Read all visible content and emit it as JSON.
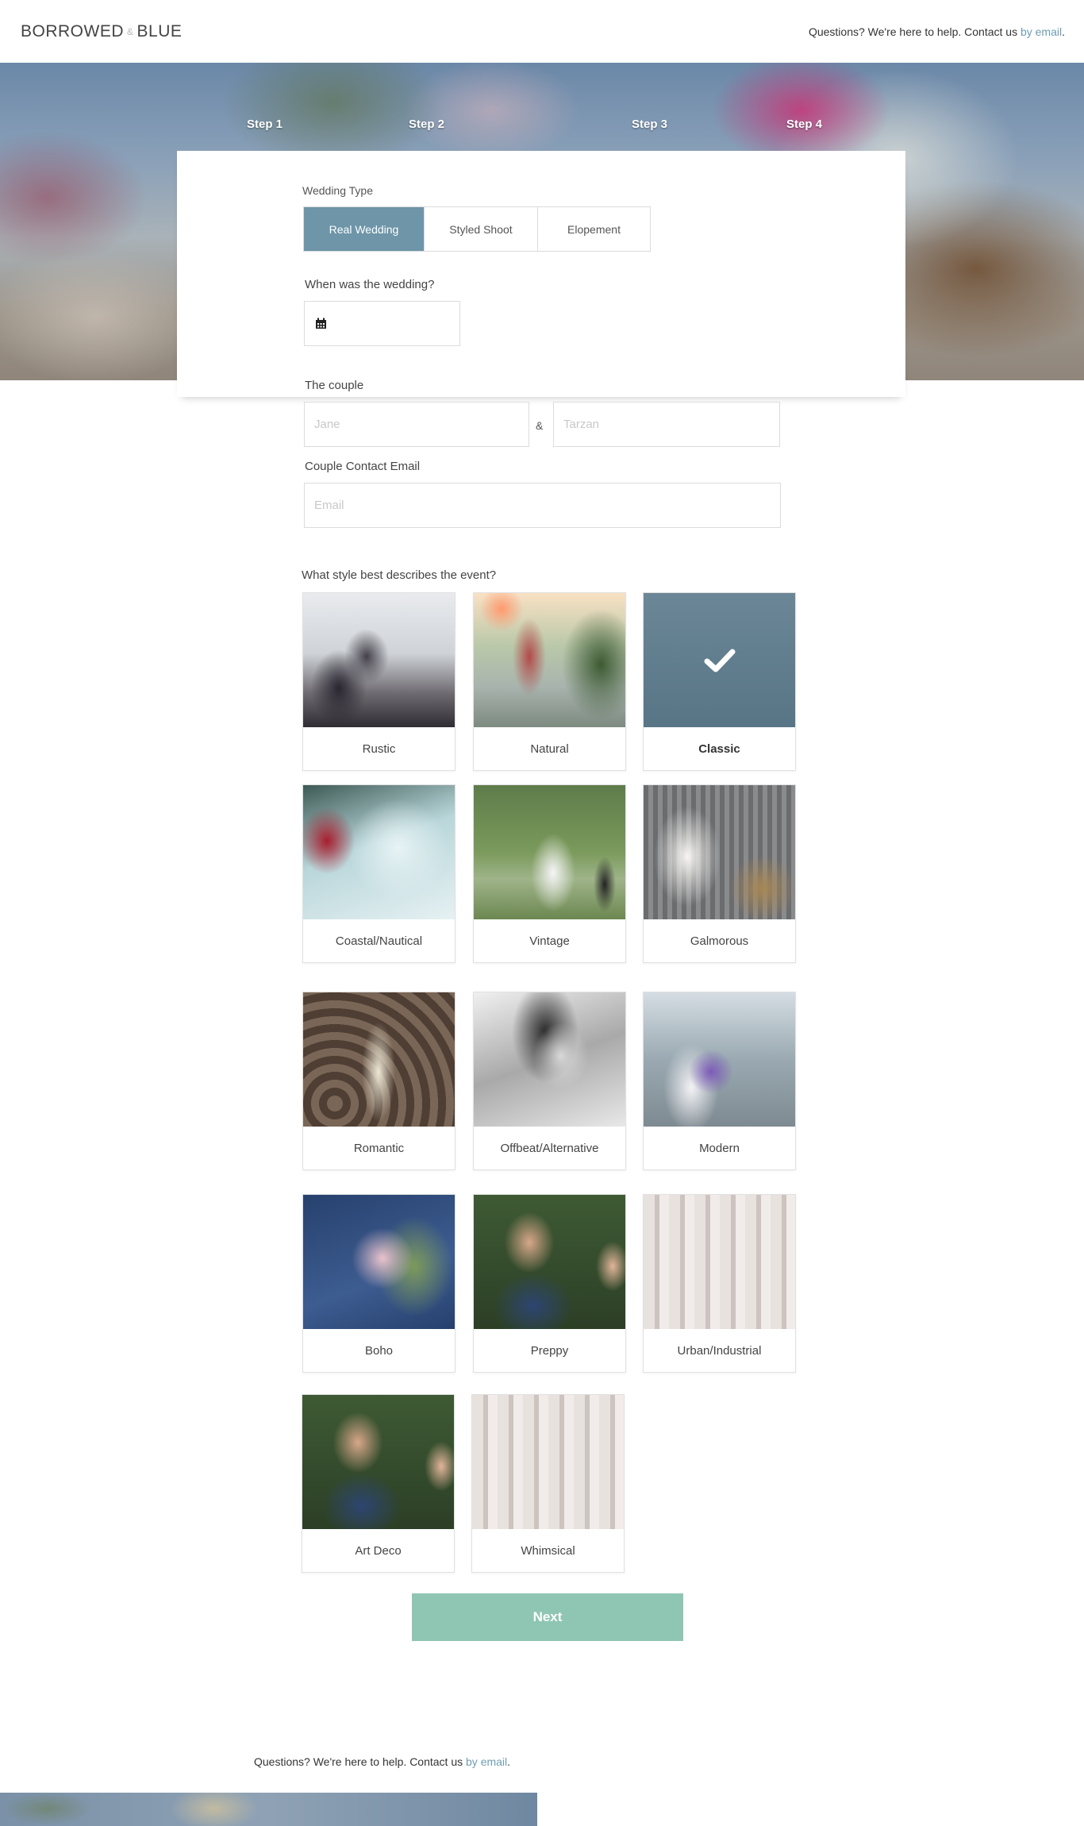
{
  "header": {
    "logo_left": "BORROWED",
    "logo_amp": "&",
    "logo_right": "BLUE",
    "help_text": "Questions? We're here to help. Contact us ",
    "help_link": "by email",
    "help_end": "."
  },
  "steps": [
    "Step 1",
    "Step 2",
    "Step 3",
    "Step 4"
  ],
  "form": {
    "wedding_type_label": "Wedding Type",
    "wedding_types": [
      "Real Wedding",
      "Styled Shoot",
      "Elopement"
    ],
    "selected_wedding_type": "Real Wedding",
    "date_label": "When was the wedding?",
    "date_value": "",
    "couple_label": "The couple",
    "partner1_placeholder": "Jane",
    "partner2_placeholder": "Tarzan",
    "couple_separator": "&",
    "email_label": "Couple Contact Email",
    "email_placeholder": "Email",
    "style_label": "What style best describes the event?"
  },
  "styles": [
    {
      "name": "Rustic",
      "selected": false
    },
    {
      "name": "Natural",
      "selected": false
    },
    {
      "name": "Classic",
      "selected": true
    },
    {
      "name": "Coastal/Nautical",
      "selected": false
    },
    {
      "name": "Vintage",
      "selected": false
    },
    {
      "name": "Galmorous",
      "selected": false
    },
    {
      "name": "Romantic",
      "selected": false
    },
    {
      "name": "Offbeat/Alternative",
      "selected": false
    },
    {
      "name": "Modern",
      "selected": false
    },
    {
      "name": "Boho",
      "selected": false
    },
    {
      "name": "Preppy",
      "selected": false
    },
    {
      "name": "Urban/Industrial",
      "selected": false
    },
    {
      "name": "Art Deco",
      "selected": false
    },
    {
      "name": "Whimsical",
      "selected": false
    }
  ],
  "next_button": "Next",
  "footer": {
    "help_text": "Questions? We're here to help. Contact us ",
    "help_link": "by email",
    "help_end": "."
  },
  "colors": {
    "accent": "#6e95a8",
    "link": "#6f9cb1",
    "next_button": "#8fc6b3"
  }
}
